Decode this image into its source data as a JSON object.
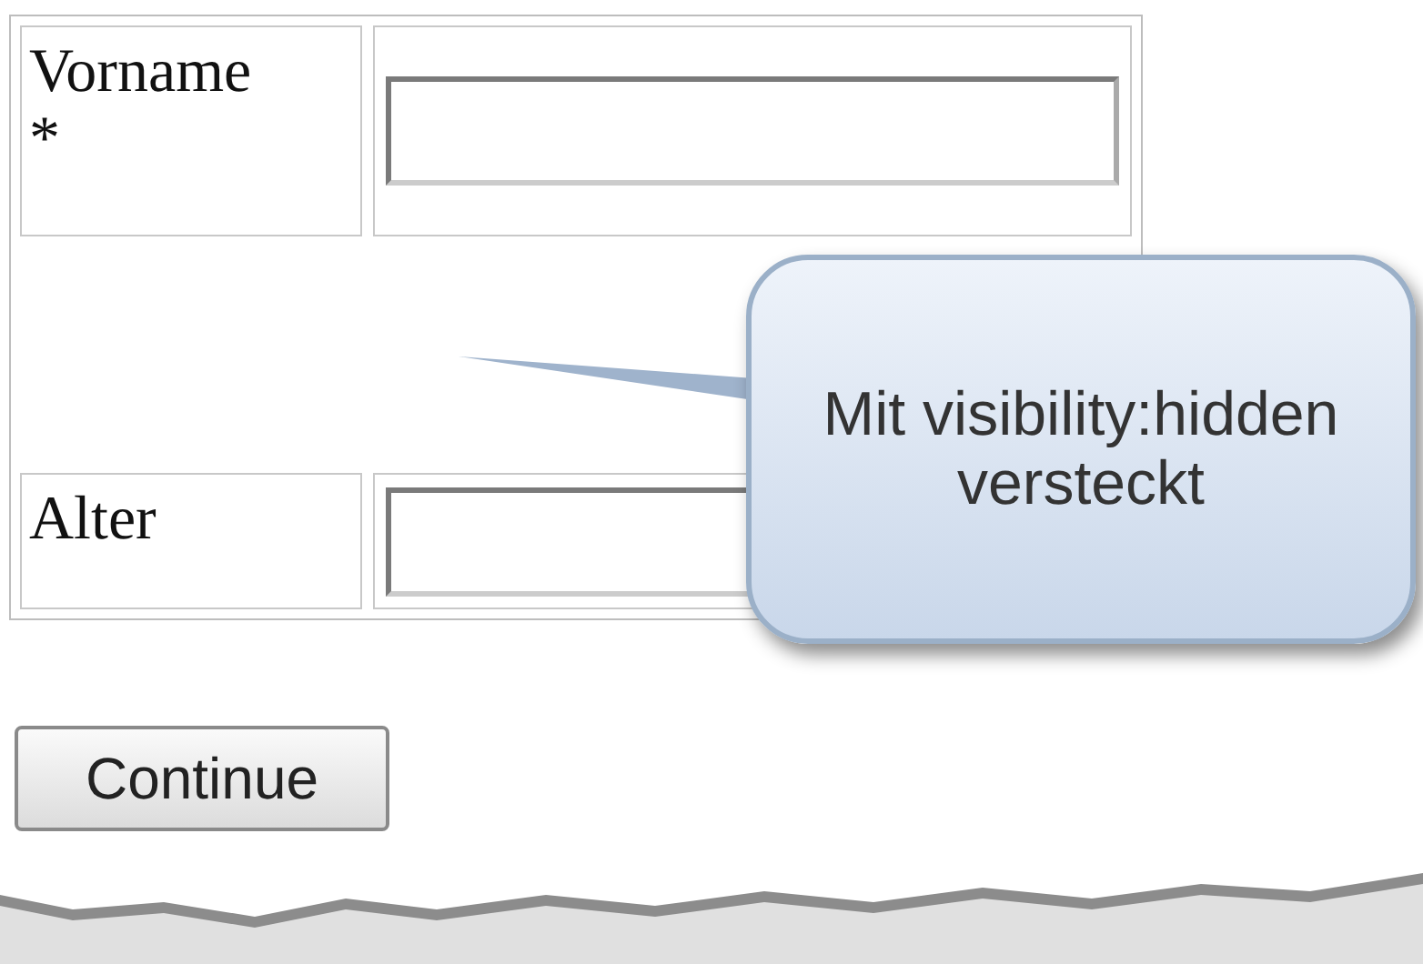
{
  "form": {
    "fields": [
      {
        "label": "Vorname",
        "required_mark": "*"
      },
      {
        "label": "Alter"
      }
    ]
  },
  "callout": {
    "text": "Mit visibility:hidden versteckt"
  },
  "buttons": [
    "Continue"
  ]
}
